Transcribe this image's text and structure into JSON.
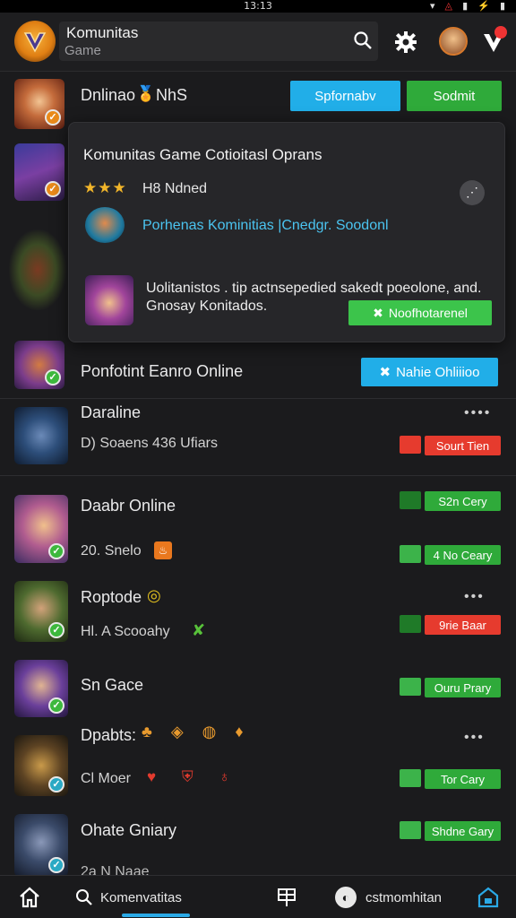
{
  "status_bar": {
    "time": "13:13"
  },
  "header": {
    "app_title": "Komunitas",
    "app_subtitle": "Game"
  },
  "top_row": {
    "title": "Dnlinao",
    "title_tail": "NhS",
    "btn_primary": "Spfornabv",
    "btn_secondary": "Sodmit"
  },
  "popup": {
    "title": "Komunitas Game Cotioitasl Oprans",
    "rating_text": "H8  Ndned",
    "link_text": "Porhenas Kominitias |Cnedgr. Soodonl",
    "message_line1": "Uolitanistos . tip actnsepedied sakedt poeolone, and.",
    "message_line2": "Gnosay  Konitados.",
    "action_button": "Noofhotarenel"
  },
  "featured": {
    "title": "Ponfotint Eanro Online",
    "button": "Nahie Ohliiioo"
  },
  "items": [
    {
      "title": "Daraline",
      "subtitle": "D)  Soaens  436  Ufiars",
      "button": "Sourt Tien",
      "status": "red"
    },
    {
      "title": "Daabr Online",
      "subtitle": "20. Snelo",
      "button": "S2n Cery",
      "status": "green"
    },
    {
      "title": "",
      "subtitle": "",
      "button": "4 No Ceary",
      "status": "green"
    },
    {
      "title": "Roptode",
      "subtitle": "Hl. A Scooahy",
      "button": "9rie Baar",
      "status": "red"
    },
    {
      "title": "Sn Gace",
      "subtitle": "",
      "button": "Ouru Prary",
      "status": "green"
    },
    {
      "title": "Dpabts:",
      "subtitle": "Cl  Moer",
      "button": "Tor Cary",
      "status": "green"
    },
    {
      "title": "Ohate Gniary",
      "subtitle": "2a N Naae",
      "button": "Shdne Gary",
      "status": "green"
    }
  ],
  "nav": {
    "search_label": "Komenvatitas",
    "profile_label": "cstmomhitan"
  },
  "colors": {
    "accent_blue": "#21aee8",
    "accent_green": "#2faa3a",
    "accent_red": "#e63b2e",
    "background": "#1b1b1d"
  }
}
